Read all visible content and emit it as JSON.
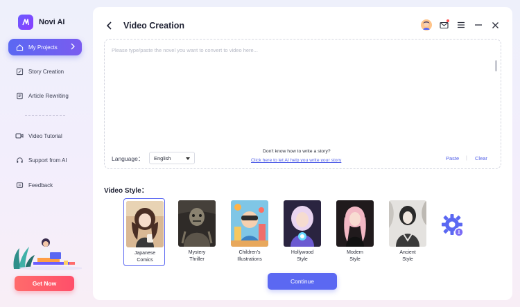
{
  "app": {
    "name": "Novi AI"
  },
  "sidebar": {
    "items": [
      {
        "label": "My Projects",
        "icon": "home-icon",
        "active": true
      },
      {
        "label": "Story Creation",
        "icon": "edit-icon"
      },
      {
        "label": "Article Rewriting",
        "icon": "document-icon"
      },
      {
        "label": "Video Tutorial",
        "icon": "video-icon"
      },
      {
        "label": "Support from AI",
        "icon": "headset-icon"
      },
      {
        "label": "Feedback",
        "icon": "message-icon"
      }
    ],
    "cta_label": "Get Now"
  },
  "header": {
    "title": "Video Creation",
    "icons": [
      "back-icon",
      "avatar",
      "mail-icon",
      "menu-icon",
      "minimize-icon",
      "close-icon"
    ]
  },
  "story": {
    "placeholder": "Please type/paste the novel you want to convert to video here...",
    "language_label": "Language：",
    "language_value": "English",
    "help_question": "Don't know how to write a story?",
    "help_link": "Click here to let AI help you write your story",
    "paste_label": "Paste",
    "separator": "|",
    "clear_label": "Clear"
  },
  "video_style": {
    "heading": "Video Style：",
    "styles": [
      {
        "label": "Japanese\nComics",
        "selected": true
      },
      {
        "label": "Mystery\nThriller"
      },
      {
        "label": "Children's\nIllustrations"
      },
      {
        "label": "Hollywood\nStyle"
      },
      {
        "label": "Modern\nStyle"
      },
      {
        "label": "Ancient\nStyle"
      }
    ]
  },
  "continue_label": "Continue",
  "colors": {
    "accent": "#5b68f2",
    "cta": "#ff5a6a",
    "link": "#5260e8"
  }
}
